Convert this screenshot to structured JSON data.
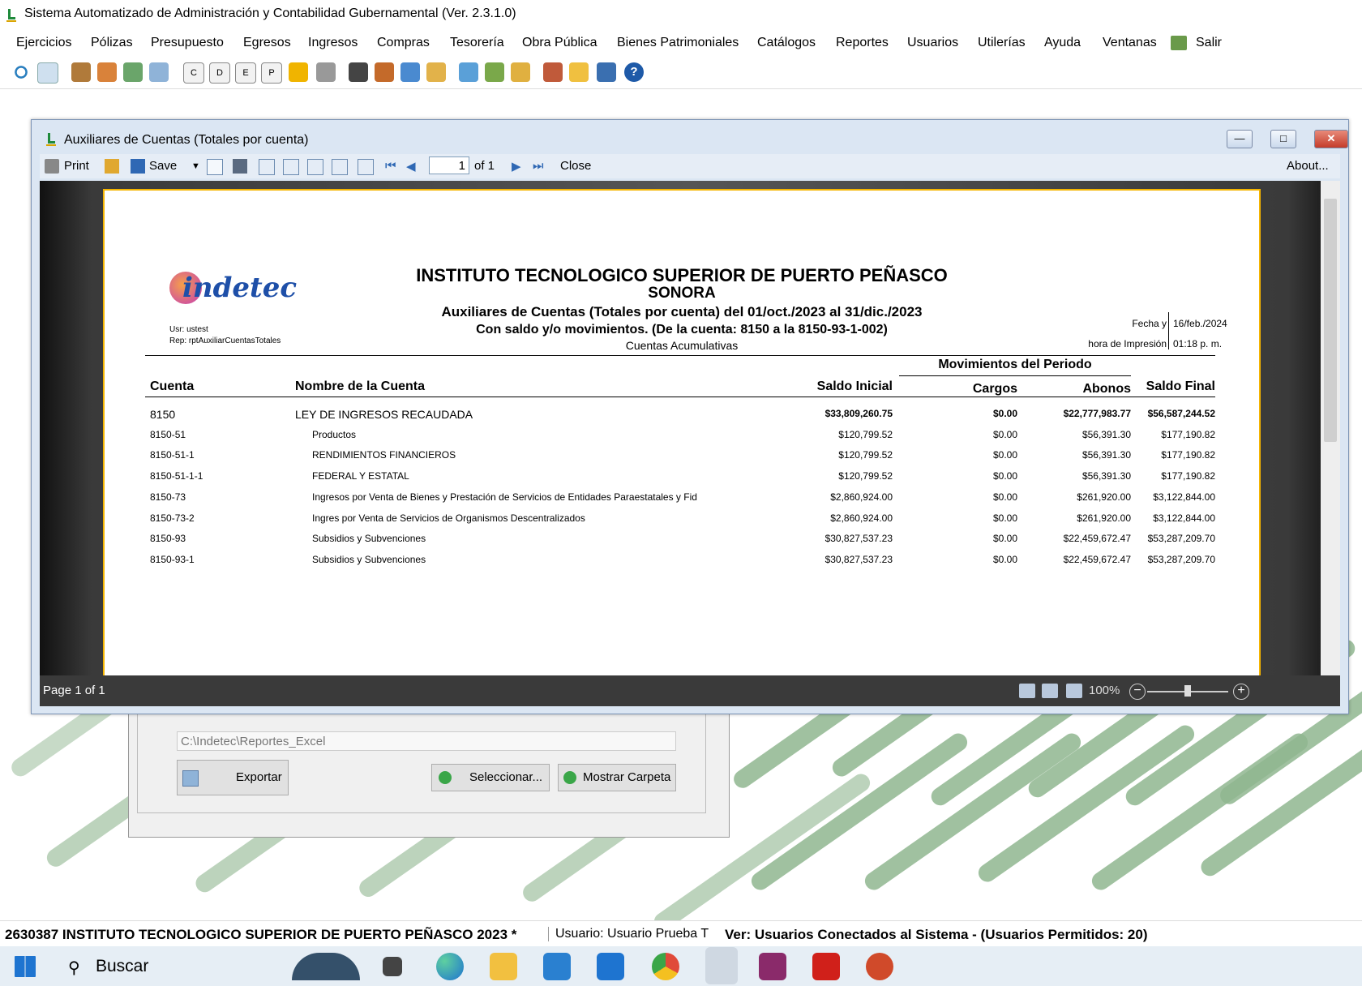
{
  "app": {
    "title": "Sistema Automatizado de Administración y Contabilidad Gubernamental  (Ver. 2.3.1.0)"
  },
  "menu": [
    "Ejercicios",
    "Pólizas",
    "Presupuesto",
    "Egresos",
    "Ingresos",
    "Compras",
    "Tesorería",
    "Obra Pública",
    "Bienes Patrimoniales",
    "Catálogos",
    "Reportes",
    "Usuarios",
    "Utilerías",
    "Ayuda",
    "Ventanas",
    "Salir"
  ],
  "report_window": {
    "title": "Auxiliares de Cuentas (Totales por cuenta)",
    "toolbar": {
      "print": "Print",
      "save": "Save",
      "page_value": "1",
      "page_of": "of 1",
      "close": "Close",
      "about": "About..."
    },
    "status": "Page 1 of 1",
    "zoom": "100%"
  },
  "report": {
    "logo": "indetec",
    "institution": "INSTITUTO TECNOLOGICO SUPERIOR DE PUERTO PEÑASCO",
    "state": "SONORA",
    "title": "Auxiliares de Cuentas (Totales por cuenta) del 01/oct./2023 al 31/dic./2023",
    "subtitle": "Con saldo y/o movimientos. (De la cuenta: 8150 a la 8150-93-1-002)",
    "subtitle2": "Cuentas Acumulativas",
    "user": "Usr: ustest",
    "rep": "Rep: rptAuxiliarCuentasTotales",
    "fecha_label": "Fecha y",
    "hora_label": "hora de Impresión",
    "fecha": "16/feb./2024",
    "hora": "01:18 p. m.",
    "group_header": "Movimientos del Periodo",
    "columns": {
      "cuenta": "Cuenta",
      "nombre": "Nombre de la Cuenta",
      "saldo_inicial": "Saldo Inicial",
      "cargos": "Cargos",
      "abonos": "Abonos",
      "saldo_final": "Saldo Final"
    },
    "rows": [
      {
        "cuenta": "8150",
        "nombre": "LEY DE INGRESOS RECAUDADA",
        "saldo_inicial": "$33,809,260.75",
        "cargos": "$0.00",
        "abonos": "$22,777,983.77",
        "saldo_final": "$56,587,244.52"
      },
      {
        "cuenta": "8150-51",
        "nombre": "Productos",
        "saldo_inicial": "$120,799.52",
        "cargos": "$0.00",
        "abonos": "$56,391.30",
        "saldo_final": "$177,190.82"
      },
      {
        "cuenta": "8150-51-1",
        "nombre": "RENDIMIENTOS FINANCIEROS",
        "saldo_inicial": "$120,799.52",
        "cargos": "$0.00",
        "abonos": "$56,391.30",
        "saldo_final": "$177,190.82"
      },
      {
        "cuenta": "8150-51-1-1",
        "nombre": "FEDERAL Y ESTATAL",
        "saldo_inicial": "$120,799.52",
        "cargos": "$0.00",
        "abonos": "$56,391.30",
        "saldo_final": "$177,190.82"
      },
      {
        "cuenta": "8150-73",
        "nombre": "Ingresos por Venta de Bienes y Prestación de Servicios de Entidades Paraestatales y Fid",
        "saldo_inicial": "$2,860,924.00",
        "cargos": "$0.00",
        "abonos": "$261,920.00",
        "saldo_final": "$3,122,844.00"
      },
      {
        "cuenta": "8150-73-2",
        "nombre": "Ingres por Venta de Servicios de Organismos Descentralizados",
        "saldo_inicial": "$2,860,924.00",
        "cargos": "$0.00",
        "abonos": "$261,920.00",
        "saldo_final": "$3,122,844.00"
      },
      {
        "cuenta": "8150-93",
        "nombre": "Subsidios y Subvenciones",
        "saldo_inicial": "$30,827,537.23",
        "cargos": "$0.00",
        "abonos": "$22,459,672.47",
        "saldo_final": "$53,287,209.70"
      },
      {
        "cuenta": "8150-93-1",
        "nombre": "Subsidios y Subvenciones",
        "saldo_inicial": "$30,827,537.23",
        "cargos": "$0.00",
        "abonos": "$22,459,672.47",
        "saldo_final": "$53,287,209.70"
      }
    ]
  },
  "dialog": {
    "path": "C:\\Indetec\\Reportes_Excel",
    "export": "Exportar",
    "select": "Seleccionar...",
    "show_folder": "Mostrar Carpeta"
  },
  "statusbar": {
    "entity": "2630387 INSTITUTO TECNOLOGICO SUPERIOR DE PUERTO PEÑASCO  2023   *",
    "user": "Usuario: Usuario Prueba T",
    "connected": "Ver: Usuarios Conectados al Sistema - (Usuarios Permitidos: 20)"
  },
  "taskbar": {
    "search": "Buscar"
  },
  "colors": {
    "accent_green": "#2e8b3a",
    "paper_border": "#f4b400",
    "window_frame": "#dbe6f3"
  }
}
